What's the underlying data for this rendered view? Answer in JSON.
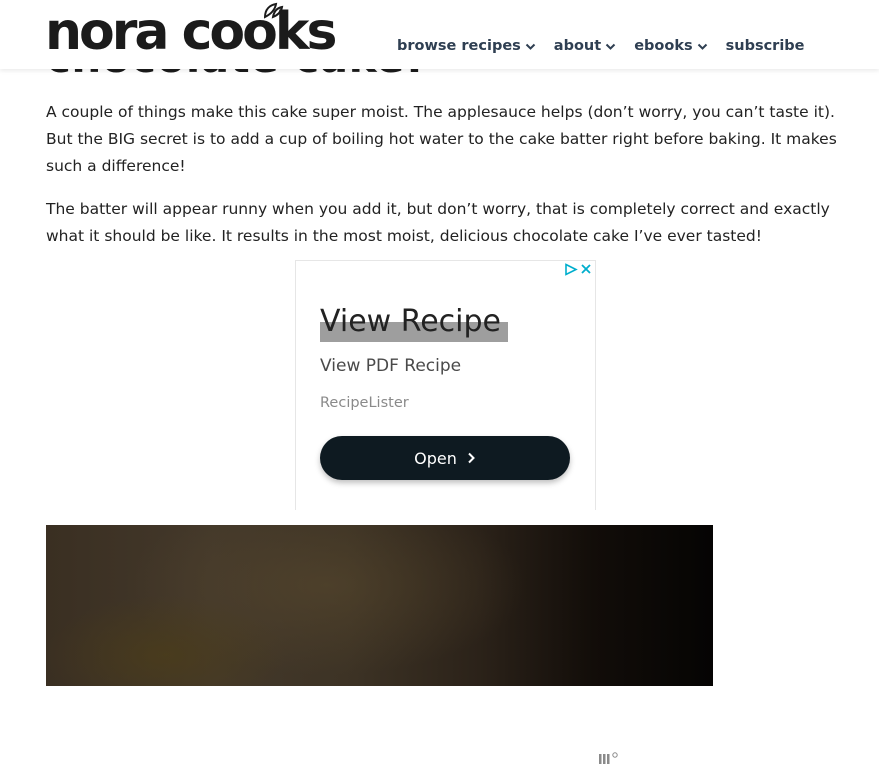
{
  "header": {
    "logo_text": "nora cooks",
    "nav": [
      {
        "label": "browse recipes",
        "has_dropdown": true
      },
      {
        "label": "about",
        "has_dropdown": true
      },
      {
        "label": "ebooks",
        "has_dropdown": true
      },
      {
        "label": "subscribe",
        "has_dropdown": false
      }
    ]
  },
  "article": {
    "partial_heading": "chocolate cake!",
    "paragraphs": [
      "A couple of things make this cake super moist. The applesauce helps (don’t worry, you can’t taste it). But the BIG secret is to add a cup of boiling hot water to the cake batter right before baking. It makes such a difference!",
      "The batter will appear runny when you add it, but don’t worry, that is completely correct and exactly what it should be like. It results in the most moist, delicious chocolate cake I’ve ever tasted!"
    ]
  },
  "ad": {
    "title": "View Recipe",
    "subtitle": "View PDF Recipe",
    "brand": "RecipeLister",
    "button_label": "Open",
    "icons": [
      "adchoices-icon",
      "close-icon",
      "chevron-right-icon",
      "ad-network-mark-icon"
    ]
  },
  "photo": {
    "icon": "chocolate-cake-photo"
  },
  "colors": {
    "nav_text": "#2f3f52",
    "body_text": "#222222",
    "ad_button_bg": "#0e1a21",
    "adchoices_blue": "#00aecd"
  }
}
